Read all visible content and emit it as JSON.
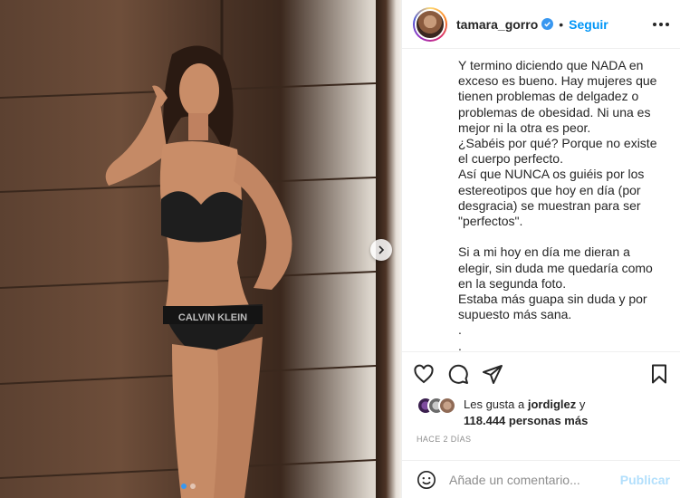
{
  "post": {
    "username": "tamara_gorro",
    "follow_label": "Seguir",
    "separator": "•",
    "caption": "Y termino diciendo que NADA en exceso es bueno. Hay mujeres que tienen problemas de delgadez o problemas de obesidad. Ni una es mejor ni la otra es peor.\n¿Sabéis por qué? Porque no existe el cuerpo perfecto.\nAsí que NUNCA os guiéis por los estereotipos que hoy en día (por desgracia) se muestran para ser \"perfectos\".\n\nSi a mi hoy en día me dieran a elegir, sin duda me quedaría como en la segunda foto.\nEstaba más guapa sin duda y por supuesto más sana.\n.\n.",
    "likes_prefix": "Les gusta a ",
    "likes_user": "jordiglez",
    "likes_connector": " y",
    "likes_count": "118.444 personas más",
    "time": "HACE 2 DÍAS",
    "comment_placeholder": "Añade un comentario...",
    "publish_label": "Publicar"
  },
  "photo": {
    "brand_text": "CALVIN KLEIN",
    "carousel_current": 1,
    "carousel_total": 2
  },
  "icons": {
    "like": "heart-icon",
    "comment": "comment-icon",
    "share": "share-icon",
    "save": "bookmark-icon",
    "emoji": "smiley-icon",
    "verified": "verified-badge-icon",
    "more": "more-options-icon",
    "next": "chevron-right-icon"
  },
  "colors": {
    "follow": "#0095f6",
    "publish_disabled": "#b2dffc",
    "verified": "#3897f0",
    "muted": "#8e8e8e"
  }
}
